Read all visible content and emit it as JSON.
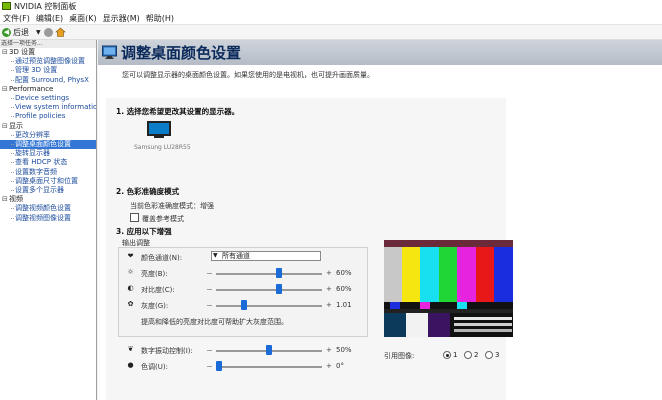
{
  "window": {
    "title": "NVIDIA 控制面板"
  },
  "menu": [
    "文件(F)",
    "编辑(E)",
    "桌面(K)",
    "显示器(M)",
    "帮助(H)"
  ],
  "toolbar": {
    "back_label": "后退"
  },
  "sidebar": {
    "header": "选择一项任务...",
    "categories": [
      {
        "label": "3D 设置",
        "items": [
          "通过预览调整图像设置",
          "管理 3D 设置",
          "配置 Surround, PhysX"
        ]
      },
      {
        "label": "Performance",
        "items": [
          "Device settings",
          "View system information",
          "Profile policies"
        ]
      },
      {
        "label": "显示",
        "items": [
          "更改分辨率",
          "调整桌面颜色设置",
          "旋转显示器",
          "查看 HDCP 状态",
          "设置数字音频",
          "调整桌面尺寸和位置",
          "设置多个显示器"
        ]
      },
      {
        "label": "视频",
        "items": [
          "调整视频颜色设置",
          "调整视频图像设置"
        ]
      }
    ],
    "selected": "调整桌面颜色设置"
  },
  "main": {
    "title": "调整桌面颜色设置",
    "subtitle": "您可以调整显示器的桌面颜色设置。如果您使用的是电视机，也可提升画面质量。",
    "section1": {
      "title": "1. 选择您希望更改其设置的显示器。",
      "display_name": "Samsung LU28R55"
    },
    "section2": {
      "title": "2. 色彩准确度模式",
      "current_mode": "当前色彩准确度模式：增强",
      "override_label": "覆盖参考模式"
    },
    "section3": {
      "title": "3. 应用以下增强",
      "output_label": "输出调整",
      "channel_label": "颜色通道(N):",
      "channel_value": "所有通道",
      "brightness_label": "亮度(B):",
      "brightness_value": "60%",
      "brightness_level": 0.6,
      "contrast_label": "对比度(C):",
      "contrast_value": "60%",
      "contrast_level": 0.6,
      "gamma_label": "灰度(G):",
      "gamma_value": "1.01",
      "gamma_level": 0.25,
      "note": "提高和降低的亮度对比度可帮助扩大灰度范围。",
      "vibrance_label": "数字振动控制(I):",
      "vibrance_value": "50%",
      "vibrance_level": 0.5,
      "hue_label": "色调(U):",
      "hue_value": "0°",
      "hue_level": 0.0,
      "minus": "－",
      "plus": "+"
    },
    "reference": {
      "label": "引用图像:",
      "options": [
        "1",
        "2",
        "3"
      ],
      "selected": "1"
    }
  }
}
